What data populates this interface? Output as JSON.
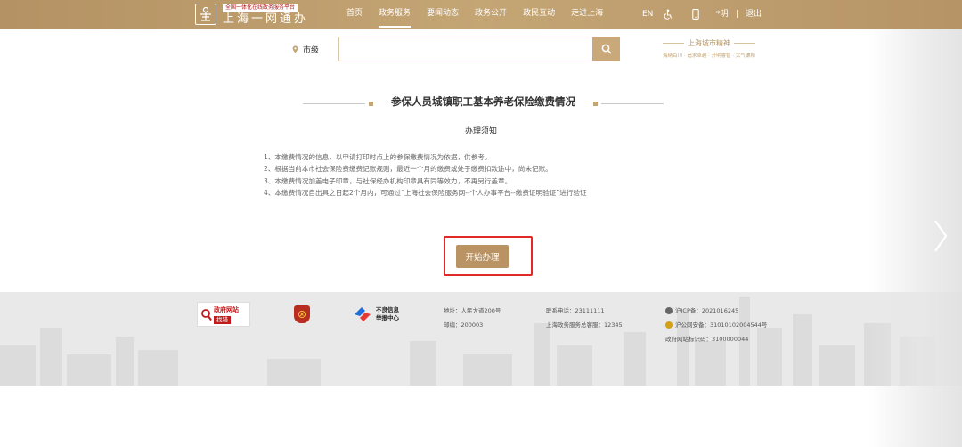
{
  "header": {
    "tagline": "全国一体化在线政务服务平台",
    "site_name": "上海一网通办",
    "nav": [
      {
        "label": "首页"
      },
      {
        "label": "政务服务",
        "active": true
      },
      {
        "label": "要闻动态"
      },
      {
        "label": "政务公开"
      },
      {
        "label": "政民互动"
      },
      {
        "label": "走进上海"
      }
    ],
    "lang": "EN",
    "user": "*明",
    "separator": "|",
    "logout": "退出",
    "icons": [
      "accessibility-icon",
      "mobile-icon"
    ]
  },
  "search": {
    "city": "市级",
    "placeholder": "",
    "value": ""
  },
  "spirit": {
    "title": "上海城市精神",
    "subtitle": "海纳百川 · 追求卓越 · 开明睿智 · 大气谦和"
  },
  "main": {
    "title": "参保人员城镇职工基本养老保险缴费情况",
    "notice_title": "办理须知",
    "notices": [
      "1、本缴费情况的信息，以申请打印时点上的参保缴费情况为依据，供参考。",
      "2、根据当前本市社会保险费缴费记账规则，最近一个月的缴费或处于缴费扣款途中，尚未记账。",
      "3、本缴费情况加盖电子印章，与社保经办机构印章具有同等效力，不再另行盖章。",
      "4、本缴费情况自出具之日起2个月内，可通过“上海社会保险服务网--个人办事平台--缴费证明验证”进行验证"
    ],
    "start_button": "开始办理"
  },
  "footer": {
    "gov_badge_top": "政府网站",
    "gov_badge_bottom": "找错",
    "report_line1": "不良信息",
    "report_line2": "举报中心",
    "address": "地址：人民大道200号",
    "postcode": "邮编：200003",
    "phone": "联系电话：23111111",
    "hotline": "上海政务服务总客服：12345",
    "icp": "沪ICP备：2021016245",
    "police": "沪公网安备：31010102004544号",
    "site_code": "政府网站标识码：3100000044"
  },
  "colors": {
    "brand_gold": "#c4a574",
    "button_gold": "#b99364",
    "highlight_red": "#e32828",
    "footer_bg": "#e9e9e9"
  }
}
